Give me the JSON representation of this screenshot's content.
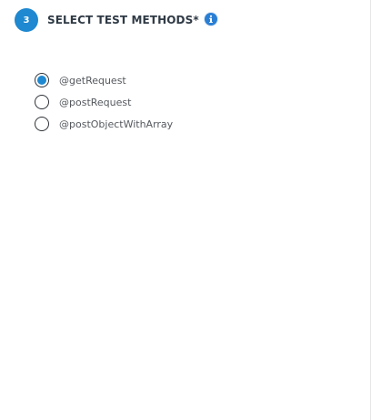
{
  "step": {
    "number": "3",
    "title": "SELECT TEST METHODS*",
    "info_icon": "info-icon"
  },
  "methods": [
    {
      "label": "@getRequest",
      "selected": true
    },
    {
      "label": "@postRequest",
      "selected": false
    },
    {
      "label": "@postObjectWithArray",
      "selected": false
    }
  ],
  "colors": {
    "accent": "#1e88d0",
    "title_text": "#2f3a45",
    "label_text": "#55595e"
  }
}
